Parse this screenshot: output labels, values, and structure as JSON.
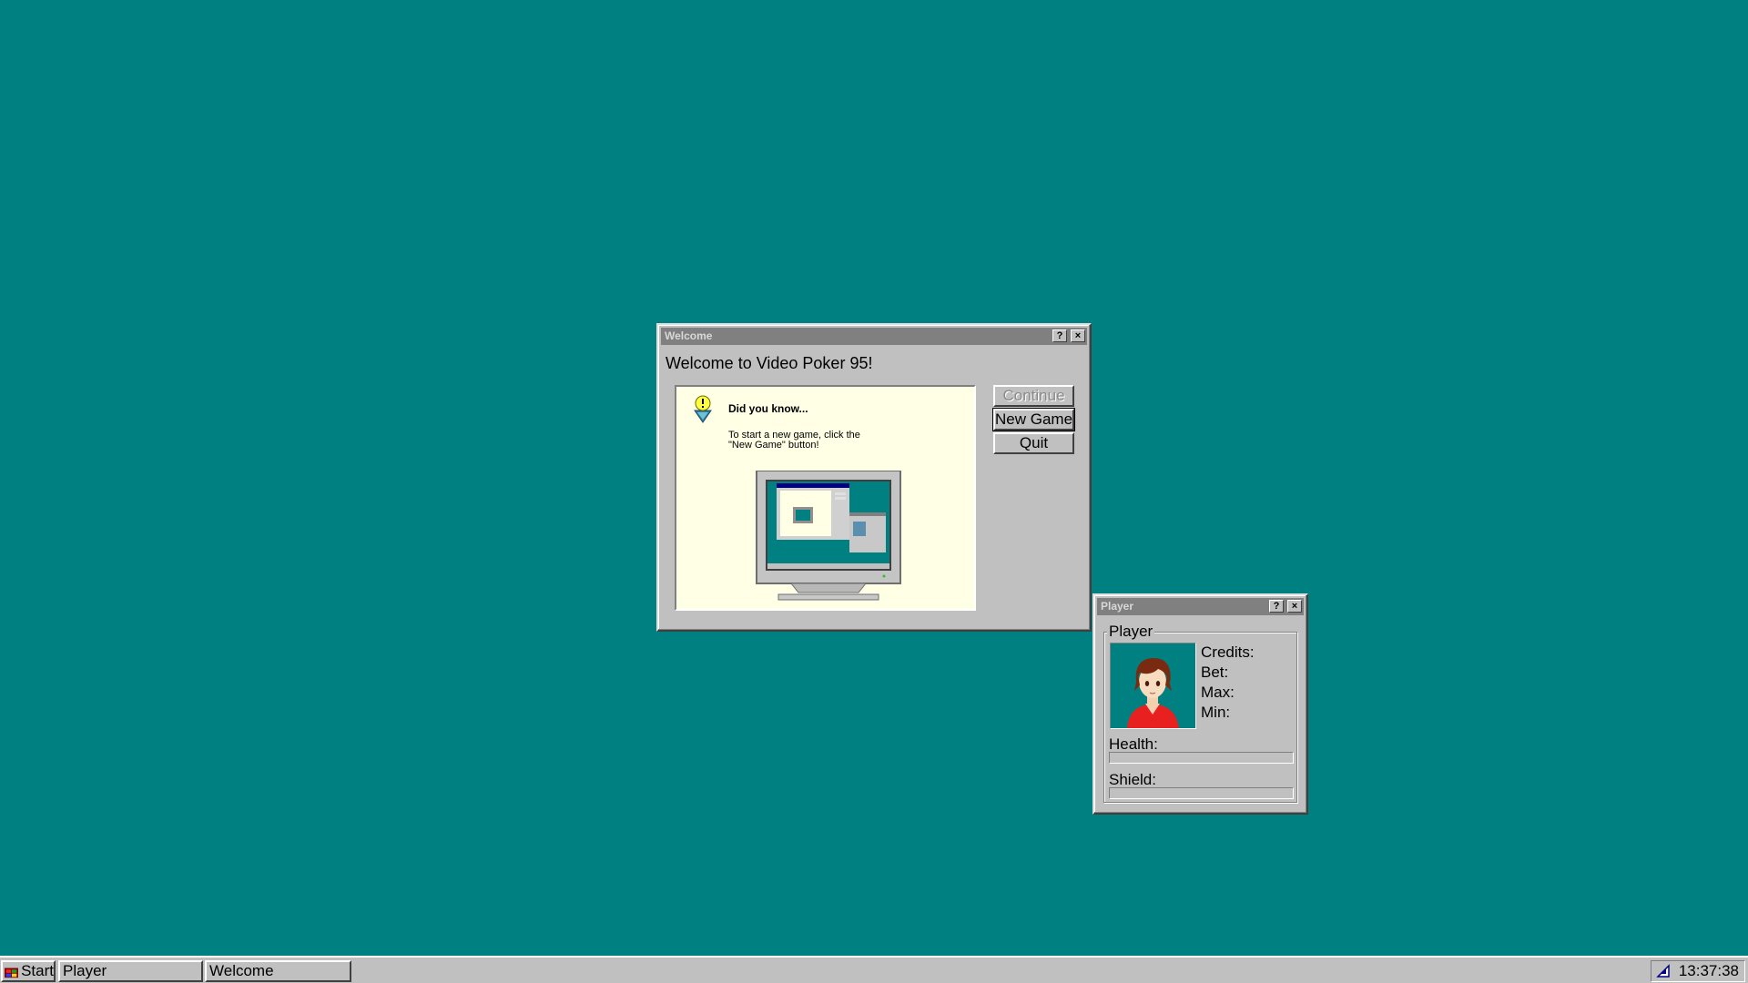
{
  "welcome_window": {
    "title": "Welcome",
    "heading": "Welcome to Video Poker 95!",
    "help_label": "?",
    "close_label": "×",
    "tip": {
      "title": "Did you know...",
      "body": "To start a new game, click the \"New Game\" button!"
    },
    "buttons": {
      "continue_label": "Continue",
      "new_game_label": "New Game",
      "quit_label": "Quit"
    }
  },
  "player_window": {
    "title": "Player",
    "help_label": "?",
    "close_label": "×",
    "group_label": "Player",
    "stats": {
      "credits_label": "Credits:",
      "bet_label": "Bet:",
      "max_label": "Max:",
      "min_label": "Min:"
    },
    "health_label": "Health:",
    "shield_label": "Shield:",
    "health_fraction": 0,
    "shield_fraction": 0
  },
  "taskbar": {
    "start_label": "Start",
    "tasks": [
      {
        "label": "Player"
      },
      {
        "label": "Welcome"
      }
    ],
    "clock": "13:37:38"
  },
  "colors": {
    "desktop": "#008080",
    "window_face": "#c0c0c0",
    "inactive_titlebar": "#808080",
    "tip_background": "#ffffe6"
  }
}
